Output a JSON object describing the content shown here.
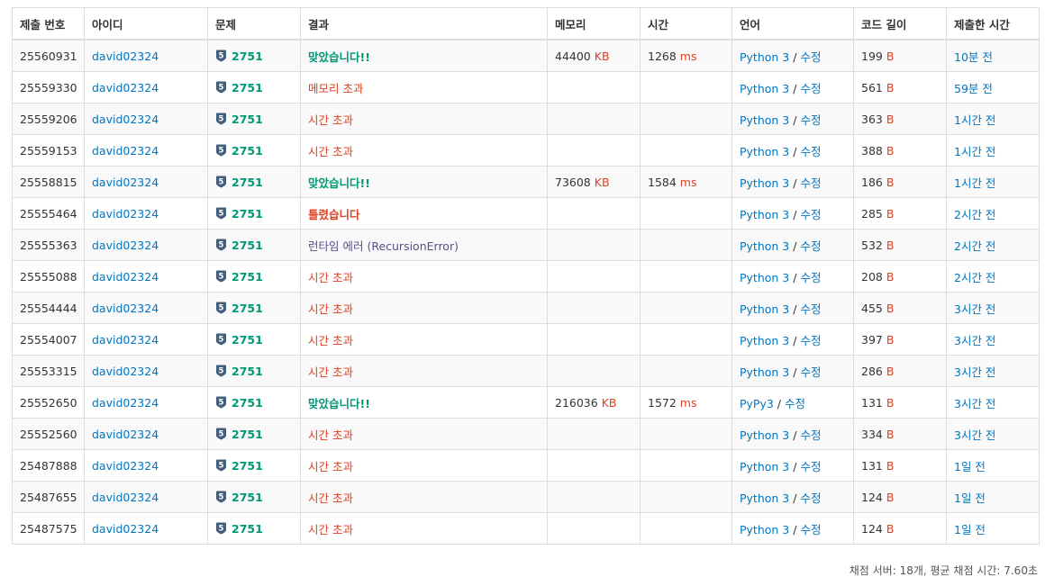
{
  "headers": [
    "제출 번호",
    "아이디",
    "문제",
    "결과",
    "메모리",
    "시간",
    "언어",
    "코드 길이",
    "제출한 시간"
  ],
  "units": {
    "memory": "KB",
    "time": "ms",
    "length": "B"
  },
  "edit_label": "수정",
  "tier_badge": "5",
  "rows": [
    {
      "id": "25560931",
      "user": "david02324",
      "problem": "2751",
      "result": "맞았습니다!!",
      "result_type": "ac",
      "memory": "44400",
      "time": "1268",
      "language": "Python 3",
      "length": "199",
      "submitted": "10분 전"
    },
    {
      "id": "25559330",
      "user": "david02324",
      "problem": "2751",
      "result": "메모리 초과",
      "result_type": "mle",
      "memory": "",
      "time": "",
      "language": "Python 3",
      "length": "561",
      "submitted": "59분 전"
    },
    {
      "id": "25559206",
      "user": "david02324",
      "problem": "2751",
      "result": "시간 초과",
      "result_type": "tle",
      "memory": "",
      "time": "",
      "language": "Python 3",
      "length": "363",
      "submitted": "1시간 전"
    },
    {
      "id": "25559153",
      "user": "david02324",
      "problem": "2751",
      "result": "시간 초과",
      "result_type": "tle",
      "memory": "",
      "time": "",
      "language": "Python 3",
      "length": "388",
      "submitted": "1시간 전"
    },
    {
      "id": "25558815",
      "user": "david02324",
      "problem": "2751",
      "result": "맞았습니다!!",
      "result_type": "ac",
      "memory": "73608",
      "time": "1584",
      "language": "Python 3",
      "length": "186",
      "submitted": "1시간 전"
    },
    {
      "id": "25555464",
      "user": "david02324",
      "problem": "2751",
      "result": "틀렸습니다",
      "result_type": "wa",
      "memory": "",
      "time": "",
      "language": "Python 3",
      "length": "285",
      "submitted": "2시간 전"
    },
    {
      "id": "25555363",
      "user": "david02324",
      "problem": "2751",
      "result": "런타임 에러 (RecursionError)",
      "result_type": "rte",
      "memory": "",
      "time": "",
      "language": "Python 3",
      "length": "532",
      "submitted": "2시간 전"
    },
    {
      "id": "25555088",
      "user": "david02324",
      "problem": "2751",
      "result": "시간 초과",
      "result_type": "tle",
      "memory": "",
      "time": "",
      "language": "Python 3",
      "length": "208",
      "submitted": "2시간 전"
    },
    {
      "id": "25554444",
      "user": "david02324",
      "problem": "2751",
      "result": "시간 초과",
      "result_type": "tle",
      "memory": "",
      "time": "",
      "language": "Python 3",
      "length": "455",
      "submitted": "3시간 전"
    },
    {
      "id": "25554007",
      "user": "david02324",
      "problem": "2751",
      "result": "시간 초과",
      "result_type": "tle",
      "memory": "",
      "time": "",
      "language": "Python 3",
      "length": "397",
      "submitted": "3시간 전"
    },
    {
      "id": "25553315",
      "user": "david02324",
      "problem": "2751",
      "result": "시간 초과",
      "result_type": "tle",
      "memory": "",
      "time": "",
      "language": "Python 3",
      "length": "286",
      "submitted": "3시간 전"
    },
    {
      "id": "25552650",
      "user": "david02324",
      "problem": "2751",
      "result": "맞았습니다!!",
      "result_type": "ac",
      "memory": "216036",
      "time": "1572",
      "language": "PyPy3",
      "length": "131",
      "submitted": "3시간 전"
    },
    {
      "id": "25552560",
      "user": "david02324",
      "problem": "2751",
      "result": "시간 초과",
      "result_type": "tle",
      "memory": "",
      "time": "",
      "language": "Python 3",
      "length": "334",
      "submitted": "3시간 전"
    },
    {
      "id": "25487888",
      "user": "david02324",
      "problem": "2751",
      "result": "시간 초과",
      "result_type": "tle",
      "memory": "",
      "time": "",
      "language": "Python 3",
      "length": "131",
      "submitted": "1일 전"
    },
    {
      "id": "25487655",
      "user": "david02324",
      "problem": "2751",
      "result": "시간 초과",
      "result_type": "tle",
      "memory": "",
      "time": "",
      "language": "Python 3",
      "length": "124",
      "submitted": "1일 전"
    },
    {
      "id": "25487575",
      "user": "david02324",
      "problem": "2751",
      "result": "시간 초과",
      "result_type": "tle",
      "memory": "",
      "time": "",
      "language": "Python 3",
      "length": "124",
      "submitted": "1일 전"
    }
  ],
  "footer": "채점 서버: 18개, 평균 채점 시간: 7.60초",
  "colors": {
    "accepted": "#009874",
    "error": "#dd4124",
    "runtime_error": "#5f4b8b",
    "link": "#0076c0",
    "tier": "#435f7a"
  }
}
